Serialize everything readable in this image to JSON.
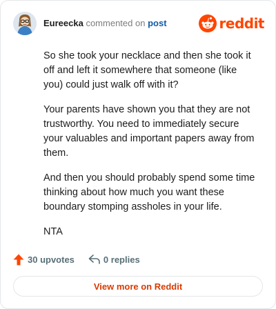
{
  "comment": {
    "author": "Eureecka",
    "action_text": "commented on",
    "post_link_label": "post",
    "paragraphs": [
      "So she took your necklace and then she took it off and left it somewhere that someone (like you) could just walk off with it?",
      "Your parents have shown you that they are not trustworthy. You need to immediately secure your valuables and important papers away from them.",
      "And then you should probably spend some time thinking about how much you want these boundary stomping assholes in your life.",
      "NTA"
    ]
  },
  "brand": {
    "wordmark": "reddit",
    "icon": "reddit-alien-logo",
    "color": "#ff4500"
  },
  "footer": {
    "upvotes_label": "30 upvotes",
    "upvote_icon": "upvote-arrow-icon",
    "upvote_color": "#ff4500",
    "replies_label": "0 replies",
    "reply_icon": "reply-arrow-icon"
  },
  "cta": {
    "label": "View more on Reddit"
  }
}
